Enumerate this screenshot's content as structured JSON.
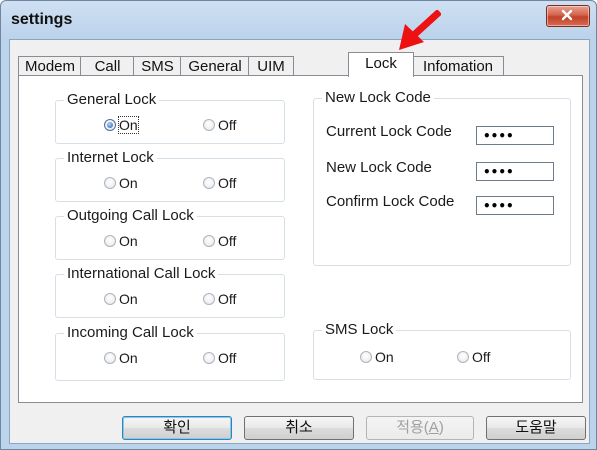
{
  "window": {
    "title": "settings"
  },
  "tabs": [
    {
      "label": "Modem",
      "active": false
    },
    {
      "label": "Call",
      "active": false
    },
    {
      "label": "SMS",
      "active": false
    },
    {
      "label": "General",
      "active": false
    },
    {
      "label": "UIM",
      "active": false
    },
    {
      "label": "Lock",
      "active": true
    },
    {
      "label": "Infomation",
      "active": false
    }
  ],
  "lock_groups": [
    {
      "label": "General Lock",
      "on": "On",
      "off": "Off",
      "selected": "On"
    },
    {
      "label": "Internet Lock",
      "on": "On",
      "off": "Off",
      "selected": null
    },
    {
      "label": "Outgoing Call Lock",
      "on": "On",
      "off": "Off",
      "selected": null
    },
    {
      "label": "International Call Lock",
      "on": "On",
      "off": "Off",
      "selected": null
    },
    {
      "label": "Incoming Call Lock",
      "on": "On",
      "off": "Off",
      "selected": null
    }
  ],
  "new_lock_code": {
    "label": "New Lock Code",
    "current_label": "Current Lock Code",
    "current_value": "••••",
    "new_label": "New Lock Code",
    "new_value": "••••",
    "confirm_label": "Confirm Lock Code",
    "confirm_value": "••••"
  },
  "sms_lock": {
    "label": "SMS Lock",
    "on": "On",
    "off": "Off",
    "selected": null
  },
  "buttons": {
    "ok": "확인",
    "cancel": "취소",
    "apply_prefix": "적용(",
    "apply_key": "A",
    "apply_suffix": ")",
    "help": "도움말"
  },
  "colors": {
    "arrow": "#ee1111",
    "selected_radio": "#1c57a8",
    "close_button": "#c2412a"
  }
}
